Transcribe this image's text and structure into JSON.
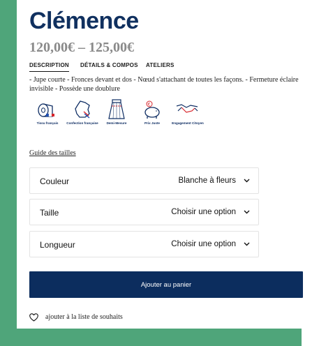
{
  "product": {
    "title": "Clémence",
    "price": "120,00€ – 125,00€"
  },
  "tabs": [
    {
      "label": "DESCRIPTION",
      "active": true
    },
    {
      "label": "DÉTAILS & COMPOS",
      "active": false
    },
    {
      "label": "ATELIERS",
      "active": false
    }
  ],
  "description": "- Jupe courte - Fronces devant et dos - Nœud s'attachant de toutes les façons. - Fermeture éclaire invisible - Possède une doublure",
  "badges": [
    {
      "label": "Tissu français",
      "icon": "fabric-roll-icon"
    },
    {
      "label": "Confection française",
      "icon": "france-map-icon"
    },
    {
      "label": "Demi-Mesure",
      "icon": "skirt-icon"
    },
    {
      "label": "Prix Juste",
      "icon": "piggy-bank-icon"
    },
    {
      "label": "Engagement Citoyen",
      "icon": "handshake-icon"
    }
  ],
  "size_guide": "Guide des tailles",
  "options": [
    {
      "label": "Couleur",
      "value": "Blanche à fleurs"
    },
    {
      "label": "Taille",
      "value": "Choisir une option"
    },
    {
      "label": "Longueur",
      "value": "Choisir une option"
    }
  ],
  "add_to_cart": "Ajouter au panier",
  "wishlist": "ajouter à la liste de souhaits",
  "colors": {
    "brand": "#0c2d5e",
    "accent_green": "#4fa57a",
    "price_gray": "#8a8a8a"
  }
}
